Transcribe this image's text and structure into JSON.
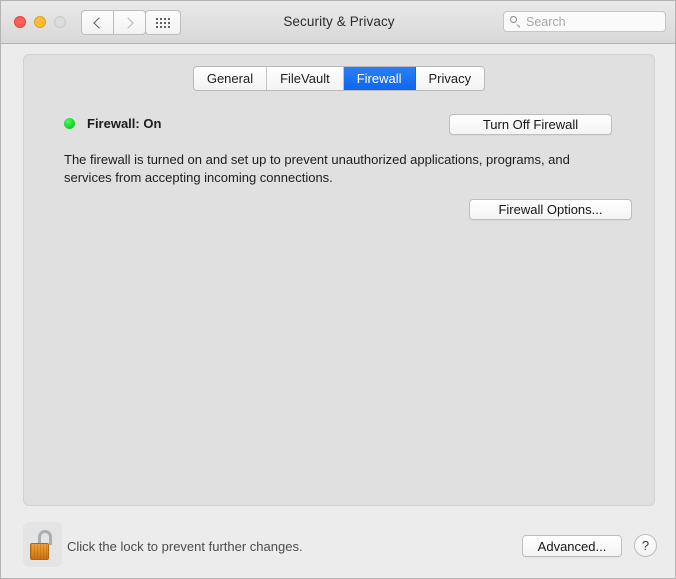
{
  "window": {
    "title": "Security & Privacy",
    "traffic_lights": {
      "close": "close-button",
      "minimize": "minimize-button",
      "zoom": "zoom-button"
    },
    "nav": {
      "back": "back-button",
      "forward": "forward-button",
      "show_all": "show-all-button"
    },
    "search": {
      "placeholder": "Search",
      "value": ""
    }
  },
  "tabs": [
    {
      "label": "General",
      "active": false
    },
    {
      "label": "FileVault",
      "active": false
    },
    {
      "label": "Firewall",
      "active": true
    },
    {
      "label": "Privacy",
      "active": false
    }
  ],
  "firewall": {
    "status_label": "Firewall: On",
    "status_color": "#14dc2c",
    "toggle_button": "Turn Off Firewall",
    "description": "The firewall is turned on and set up to prevent unauthorized applications, programs, and services from accepting incoming connections.",
    "options_button": "Firewall Options..."
  },
  "footer": {
    "lock_state": "unlocked",
    "lock_text": "Click the lock to prevent further changes.",
    "advanced_button": "Advanced...",
    "help_button": "?"
  },
  "colors": {
    "accent_blue": "#0f66ef",
    "window_bg": "#ececec",
    "panel_bg": "#e0e0e0",
    "lock_gold": "#e08a22"
  }
}
